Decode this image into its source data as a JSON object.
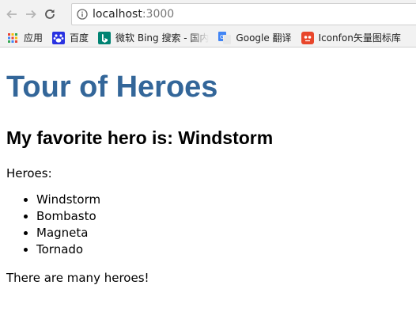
{
  "browser": {
    "url_host": "localhost",
    "url_port": ":3000"
  },
  "bookmarks": [
    {
      "label": "应用",
      "icon": "apps-grid-icon"
    },
    {
      "label": "百度",
      "icon": "baidu-paw-icon"
    },
    {
      "label": "微软 Bing 搜索 - 国内",
      "icon": "bing-icon"
    },
    {
      "label": "Google 翻译",
      "icon": "google-translate-icon"
    },
    {
      "label": "Iconfon矢量图标库",
      "icon": "iconfont-icon"
    }
  ],
  "page": {
    "title": "Tour of Heroes",
    "favorite_prefix": "My favorite hero is: ",
    "favorite_name": "Windstorm",
    "heroes_label": "Heroes:",
    "heroes": [
      "Windstorm",
      "Bombasto",
      "Magneta",
      "Tornado"
    ],
    "many_message": "There are many heroes!"
  },
  "colors": {
    "title": "#336699",
    "toolbar_bg": "#f2f2f2"
  }
}
